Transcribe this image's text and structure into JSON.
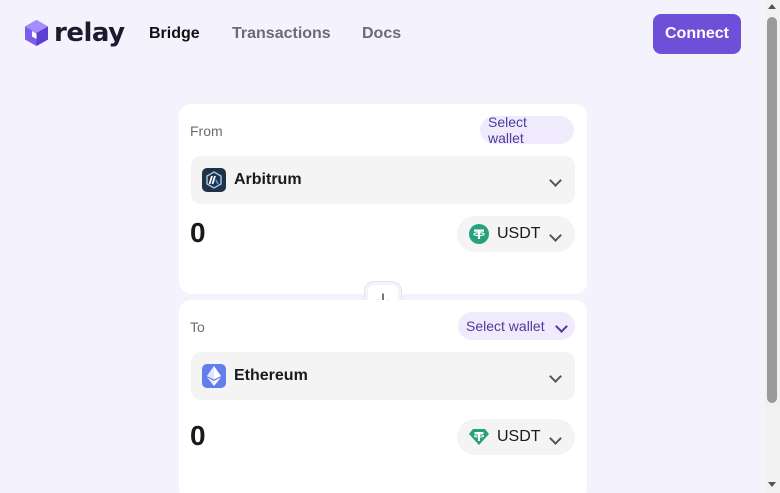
{
  "brand": {
    "name": "relay",
    "accent": "#6e4fd8"
  },
  "nav": {
    "links": [
      {
        "label": "Bridge",
        "active": true
      },
      {
        "label": "Transactions",
        "active": false
      },
      {
        "label": "Docs",
        "active": false
      }
    ],
    "connect_label": "Connect"
  },
  "from": {
    "label": "From",
    "wallet_label": "Select wallet",
    "chain": {
      "name": "Arbitrum",
      "icon": "arbitrum-icon"
    },
    "amount": "0",
    "token": {
      "symbol": "USDT",
      "icon": "tether-icon"
    }
  },
  "swap": {
    "icon": "arrow-down-icon"
  },
  "to": {
    "label": "To",
    "wallet_label": "Select wallet",
    "chain": {
      "name": "Ethereum",
      "icon": "ethereum-icon"
    },
    "amount": "0",
    "token": {
      "symbol": "USDT",
      "icon": "tether-icon"
    }
  }
}
